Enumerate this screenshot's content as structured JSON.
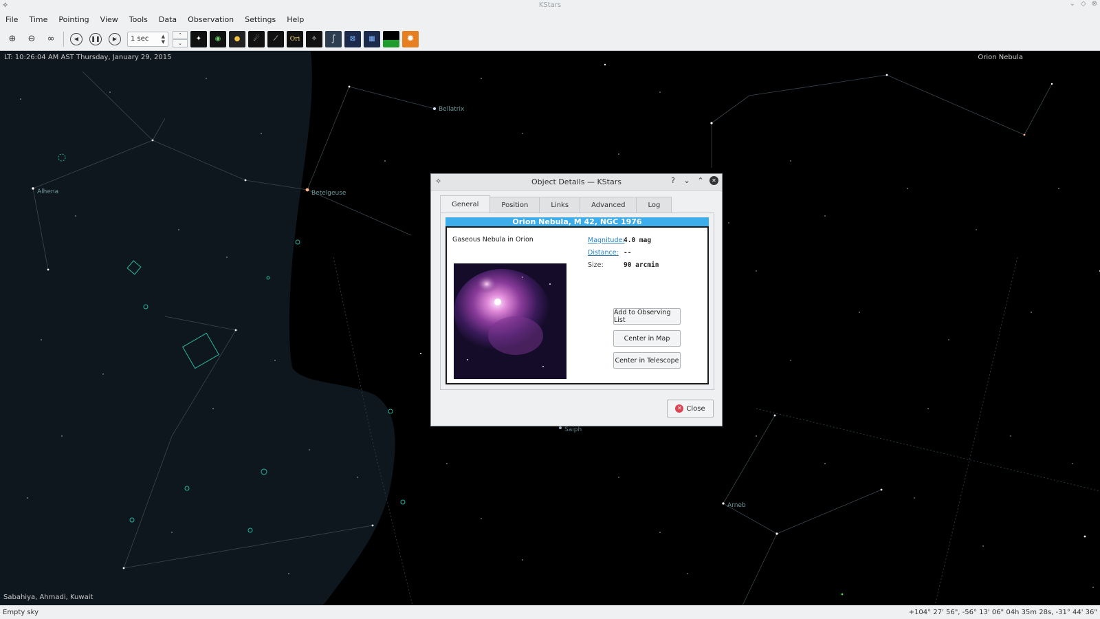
{
  "window": {
    "title": "KStars"
  },
  "menu": [
    "File",
    "Time",
    "Pointing",
    "View",
    "Tools",
    "Data",
    "Observation",
    "Settings",
    "Help"
  ],
  "toolbar": {
    "time_step": "1 sec",
    "ori_label": "Ori"
  },
  "sky": {
    "clock": "LT: 10:26:04 AM AST   Thursday, January 29, 2015",
    "focus_object": "Orion Nebula",
    "location": "Sabahiya, Ahmadi, Kuwait",
    "labels": {
      "bellatrix": "Bellatrix",
      "betelgeuse": "Betelgeuse",
      "alhena": "Alhena",
      "saiph": "Saiph",
      "arneb": "Arneb"
    }
  },
  "status": {
    "left": "Empty sky",
    "right": "+104° 27' 56\", -56° 13' 06\"  04h 35m 28s, -31° 44' 36\""
  },
  "dialog": {
    "title": "Object Details — KStars",
    "tabs": [
      "General",
      "Position",
      "Links",
      "Advanced",
      "Log"
    ],
    "object_name": "Orion Nebula, M 42, NGC 1976",
    "object_type": "Gaseous Nebula in Orion",
    "magnitude_label": "Magnitude:",
    "magnitude_value": "4.0 mag",
    "distance_label": "Distance:",
    "distance_value": "--",
    "size_label": "Size:",
    "size_value": "90 arcmin",
    "add_button": "Add to Observing List",
    "center_map_button": "Center in Map",
    "center_telescope_button": "Center in Telescope",
    "close_button": "Close"
  }
}
